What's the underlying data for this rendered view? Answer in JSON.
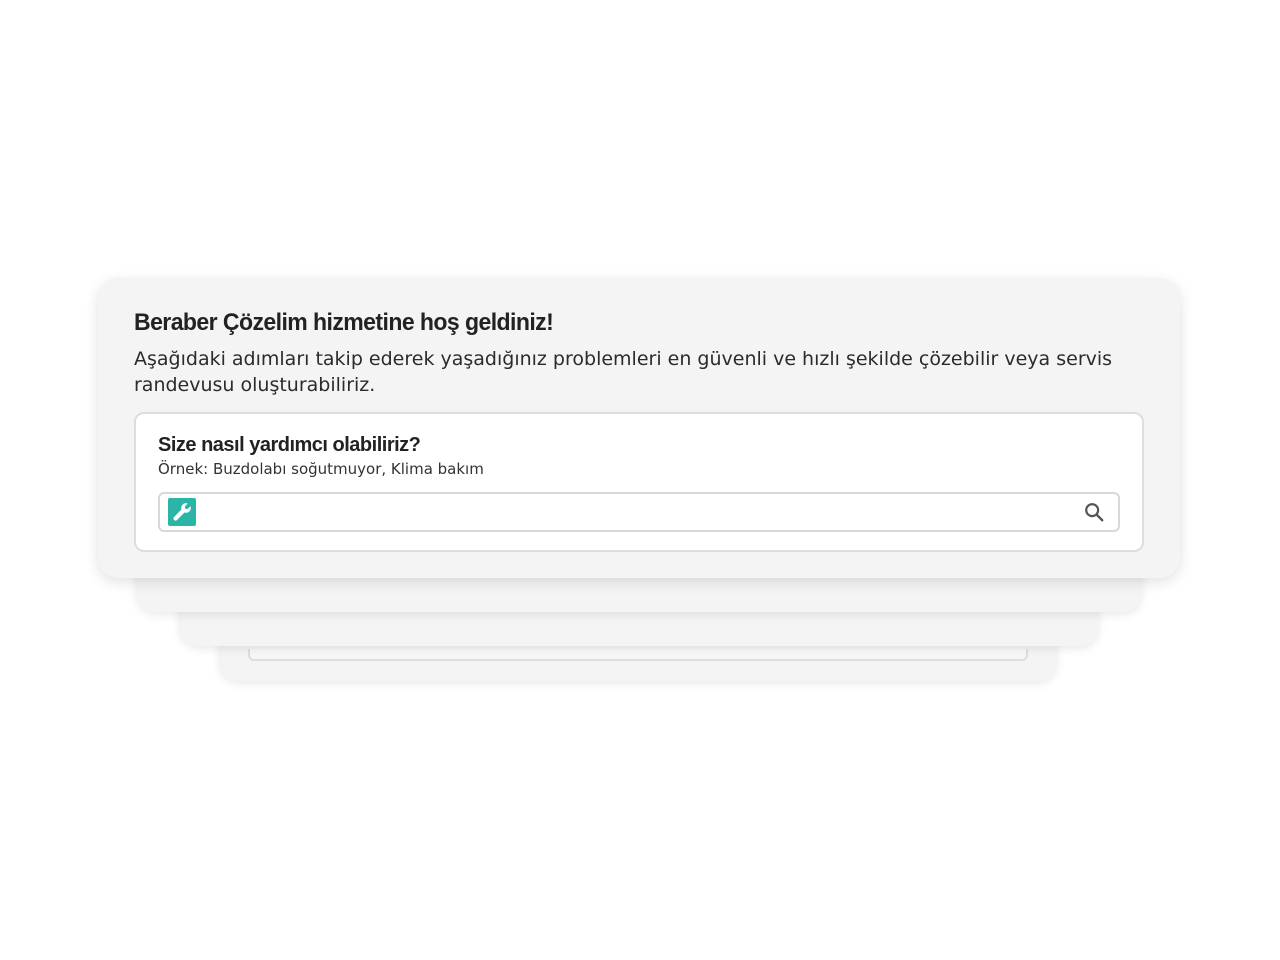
{
  "welcome": {
    "title": "Beraber Çözelim hizmetine hoş geldiniz!",
    "description": "Aşağıdaki adımları takip ederek yaşadığınız problemleri en güvenli ve hızlı şekilde çözebilir veya servis randevusu oluşturabiliriz."
  },
  "search": {
    "heading": "Size nasıl yardımcı olabiliriz?",
    "example": "Örnek: Buzdolabı soğutmuyor, Klima bakım",
    "value": "",
    "placeholder": "",
    "leading_icon": "wrench-icon",
    "trailing_icon": "search-icon"
  },
  "colors": {
    "accent": "#2bb5a6",
    "card_background": "#f4f4f4",
    "text": "#222222"
  }
}
